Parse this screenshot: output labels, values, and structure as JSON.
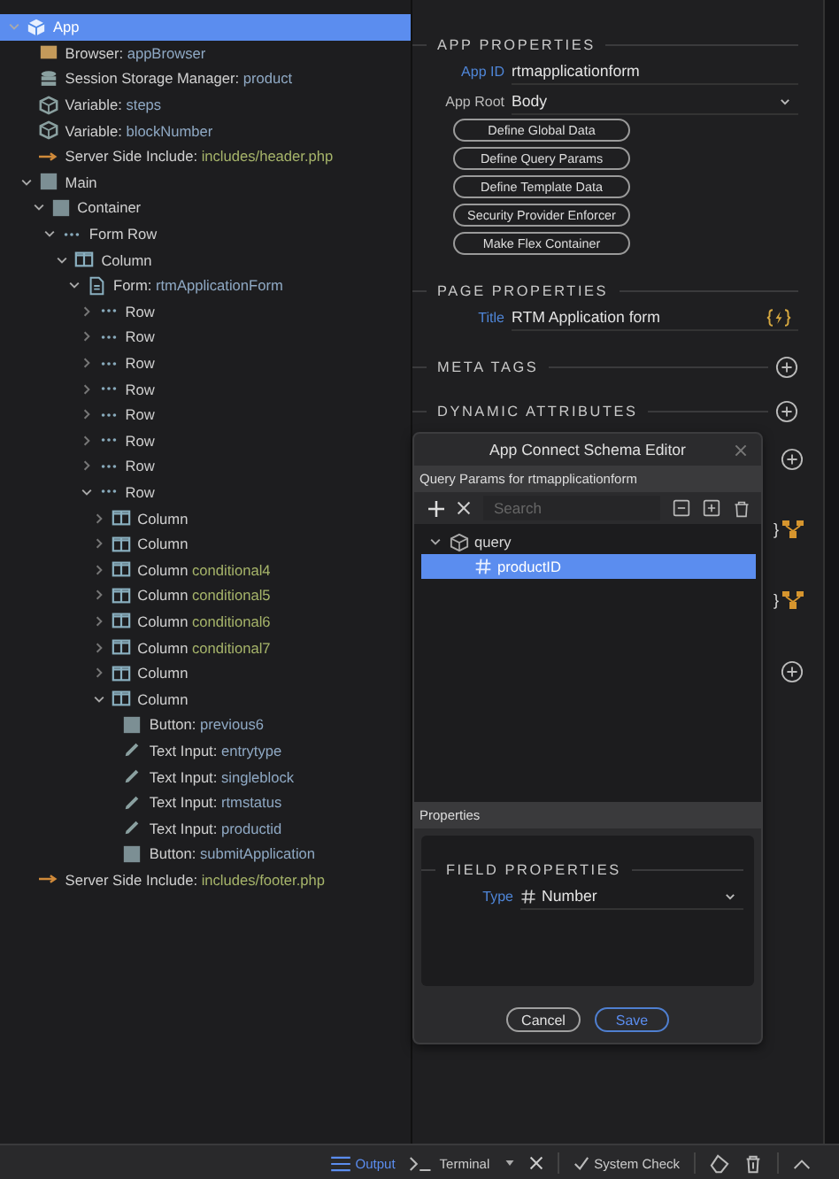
{
  "tree": [
    {
      "label": "App",
      "kind": "app",
      "expanded": true,
      "selected": true,
      "children": [
        {
          "label": "Browser: ",
          "value": "appBrowser",
          "kind": "browser",
          "selected": false
        },
        {
          "label": "Session Storage Manager: ",
          "value": "product",
          "kind": "storage",
          "selected": false
        },
        {
          "label": "Variable: ",
          "value": "steps",
          "kind": "variable",
          "selected": false
        },
        {
          "label": "Variable: ",
          "value": "blockNumber",
          "kind": "variable",
          "selected": false
        },
        {
          "label": "Server Side Include: ",
          "value": "includes/header.php",
          "kind": "include",
          "selected": false
        },
        {
          "label": "Main",
          "kind": "block",
          "expanded": true,
          "selected": false,
          "children": [
            {
              "label": "Container",
              "kind": "block",
              "expanded": true,
              "selected": false,
              "children": [
                {
                  "label": "Form Row",
                  "kind": "row",
                  "expanded": true,
                  "selected": false,
                  "children": [
                    {
                      "label": "Column",
                      "kind": "column",
                      "expanded": true,
                      "selected": false,
                      "children": [
                        {
                          "label": "Form: ",
                          "value": "rtmApplicationForm",
                          "kind": "form",
                          "expanded": true,
                          "selected": false,
                          "children": [
                            {
                              "label": "Row",
                              "kind": "row",
                              "expanded": false,
                              "selected": false
                            },
                            {
                              "label": "Row",
                              "kind": "row",
                              "expanded": false,
                              "selected": false
                            },
                            {
                              "label": "Row",
                              "kind": "row",
                              "expanded": false,
                              "selected": false
                            },
                            {
                              "label": "Row",
                              "kind": "row",
                              "expanded": false,
                              "selected": false
                            },
                            {
                              "label": "Row",
                              "kind": "row",
                              "expanded": false,
                              "selected": false
                            },
                            {
                              "label": "Row",
                              "kind": "row",
                              "expanded": false,
                              "selected": false
                            },
                            {
                              "label": "Row",
                              "kind": "row",
                              "expanded": false,
                              "selected": false
                            },
                            {
                              "label": "Row",
                              "kind": "row",
                              "expanded": true,
                              "selected": false,
                              "children": [
                                {
                                  "label": "Column",
                                  "kind": "column",
                                  "expanded": false,
                                  "selected": false
                                },
                                {
                                  "label": "Column",
                                  "kind": "column",
                                  "expanded": false,
                                  "selected": false
                                },
                                {
                                  "label": "Column ",
                                  "value": "conditional4",
                                  "kind": "column",
                                  "expanded": false,
                                  "selected": false
                                },
                                {
                                  "label": "Column ",
                                  "value": "conditional5",
                                  "kind": "column",
                                  "expanded": false,
                                  "selected": false
                                },
                                {
                                  "label": "Column ",
                                  "value": "conditional6",
                                  "kind": "column",
                                  "expanded": false,
                                  "selected": false
                                },
                                {
                                  "label": "Column ",
                                  "value": "conditional7",
                                  "kind": "column",
                                  "expanded": false,
                                  "selected": false
                                },
                                {
                                  "label": "Column",
                                  "kind": "column",
                                  "expanded": false,
                                  "selected": false
                                },
                                {
                                  "label": "Column",
                                  "kind": "column",
                                  "expanded": true,
                                  "selected": false,
                                  "children": [
                                    {
                                      "label": "Button: ",
                                      "value": "previous6",
                                      "kind": "button",
                                      "selected": false
                                    },
                                    {
                                      "label": "Text Input: ",
                                      "value": "entrytype",
                                      "kind": "input",
                                      "selected": false
                                    },
                                    {
                                      "label": "Text Input: ",
                                      "value": "singleblock",
                                      "kind": "input",
                                      "selected": false
                                    },
                                    {
                                      "label": "Text Input: ",
                                      "value": "rtmstatus",
                                      "kind": "input",
                                      "selected": false
                                    },
                                    {
                                      "label": "Text Input: ",
                                      "value": "productid",
                                      "kind": "input",
                                      "selected": false
                                    },
                                    {
                                      "label": "Button: ",
                                      "value": "submitApplication",
                                      "kind": "button",
                                      "selected": false
                                    }
                                  ]
                                }
                              ]
                            }
                          ]
                        }
                      ]
                    }
                  ]
                }
              ]
            }
          ]
        },
        {
          "label": "Server Side Include: ",
          "value": "includes/footer.php",
          "kind": "include",
          "selected": false
        }
      ]
    }
  ],
  "properties": {
    "sections": [
      {
        "title": "APP PROPERTIES",
        "addable": false,
        "fields": [
          {
            "label": "App ID",
            "value": "rtmapplicationform",
            "kind": "text",
            "label_highlighted": true
          },
          {
            "label": "App Root",
            "value": "Body",
            "kind": "select",
            "label_highlighted": false
          }
        ],
        "buttons": [
          "Define Global Data",
          "Define Query Params",
          "Define Template Data",
          "Security Provider Enforcer",
          "Make Flex Container"
        ]
      },
      {
        "title": "PAGE PROPERTIES",
        "addable": false,
        "fields": [
          {
            "label": "Title",
            "value": "RTM Application form",
            "kind": "dynamic",
            "label_highlighted": true
          }
        ]
      },
      {
        "title": "META TAGS",
        "addable": true
      },
      {
        "title": "DYNAMIC ATTRIBUTES",
        "addable": true
      }
    ],
    "hidden_rows": [
      {
        "kind": "add"
      },
      {
        "kind": "link",
        "text": "}"
      },
      {
        "kind": "link",
        "text": "}"
      },
      {
        "kind": "add"
      }
    ]
  },
  "dialog": {
    "title": "App Connect Schema Editor",
    "subtitle": "Query Params for rtmapplicationform",
    "search": {
      "placeholder": "Search"
    },
    "tree": [
      {
        "label": "query",
        "kind": "object",
        "expanded": true,
        "selected": false,
        "children": [
          {
            "label": "productID",
            "kind": "number",
            "selected": true
          }
        ]
      }
    ],
    "properties_header": "Properties",
    "section": "FIELD PROPERTIES",
    "type_field": {
      "label": "Type",
      "value": "Number"
    },
    "buttons": [
      {
        "label": "Cancel",
        "kind": "secondary"
      },
      {
        "label": "Save",
        "kind": "primary"
      }
    ]
  },
  "status_bar": {
    "tabs": [
      {
        "label": "Output",
        "kind": "output",
        "selected": true
      },
      {
        "label": "Terminal",
        "kind": "terminal",
        "selected": false
      }
    ],
    "action": "System Check"
  }
}
